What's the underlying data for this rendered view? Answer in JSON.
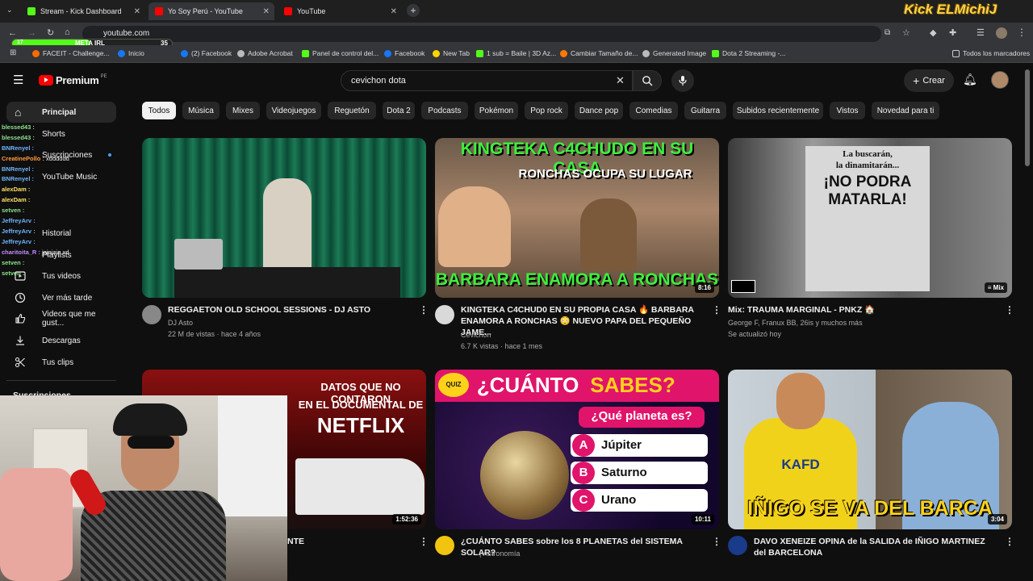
{
  "browser": {
    "tabs": [
      {
        "label": "Stream - Kick Dashboard",
        "color": "#53fc18"
      },
      {
        "label": "Yo Soy Perú - YouTube",
        "color": "#ff0000"
      },
      {
        "label": "YouTube",
        "color": "#ff0000"
      }
    ],
    "url": "youtube.com",
    "bookmarks": [
      "FACEIT - Challenge...",
      "Inicio",
      "(2) Facebook",
      "Adobe Acrobat",
      "Panel de control del...",
      "Facebook",
      "New Tab",
      "1 sub = Baile | 3D Az...",
      "Cambiar Tamaño de...",
      "Generated Image",
      "Dota 2 Streaming -...",
      "Todos los marcadores"
    ]
  },
  "overlay": {
    "brand": "Kick ELMichiJ",
    "meta_label": "META IRL",
    "meta_current": "17",
    "meta_goal": "35",
    "meta_fraction": 0.49,
    "chat": [
      {
        "user": "blessed43 :",
        "msg": ""
      },
      {
        "user": "blessed43 :",
        "msg": ""
      },
      {
        "user": "BNRenyel :",
        "msg": ""
      },
      {
        "user": "CreatinePollo :",
        "msg": "xdddddd"
      },
      {
        "user": "BNRenyel :",
        "msg": ""
      },
      {
        "user": "BNRenyel :",
        "msg": ""
      },
      {
        "user": "alexDam :",
        "msg": ""
      },
      {
        "user": "alexDam :",
        "msg": ""
      },
      {
        "user": "setven :",
        "msg": ""
      },
      {
        "user": "JeffreyArv :",
        "msg": ""
      },
      {
        "user": "JeffreyArv :",
        "msg": ""
      },
      {
        "user": "JeffreyArv :",
        "msg": ""
      },
      {
        "user": "charitoita_R :",
        "msg": "jajajaja xd"
      },
      {
        "user": "setven :",
        "msg": ""
      },
      {
        "user": "setven :",
        "msg": ""
      }
    ]
  },
  "header": {
    "logo": "Premium",
    "region": "PE",
    "search_value": "cevichon dota",
    "create_label": "Crear"
  },
  "chips": [
    "Todos",
    "Música",
    "Mixes",
    "Videojuegos",
    "Reguetón",
    "Dota 2",
    "Podcasts",
    "Pokémon",
    "Pop rock",
    "Dance pop",
    "Comedias",
    "Guitarra",
    "Subidos recientemente",
    "Vistos",
    "Novedad para ti"
  ],
  "sidebar": {
    "items": [
      "Principal",
      "Shorts",
      "Suscripciones",
      "YouTube Music",
      "Historial",
      "Playlists",
      "Tus videos",
      "Ver más tarde",
      "Videos que me gust...",
      "Descargas",
      "Tus clips"
    ],
    "section": "Suscripciones"
  },
  "videos": [
    {
      "title": "REGGAETON OLD SCHOOL SESSIONS - DJ ASTO",
      "channel": "DJ Asto",
      "stats": "22 M de vistas · hace 4 años",
      "duration": ""
    },
    {
      "title": "KINGTEKA C4CHUD0 EN SU PROPIA CASA 🔥 BARBARA ENAMORA A RONCHAS 😳 NUEVO PAPA DEL PEQUEÑO JAME...",
      "channel": "Cevichon",
      "stats": "6.7 K vistas · hace 1 mes",
      "duration": "8:16",
      "thumb_top": "KINGTEKA C4CHUDO EN SU CASA",
      "thumb_mid": "RONCHAS OCUPA SU LUGAR",
      "thumb_bottom": "BARBARA ENAMORA A RONCHAS"
    },
    {
      "title": "Mix: TRAUMA MARGINAL - PNKZ 🏠",
      "channel": "George F, Franux BB, 26is y muchos más",
      "stats": "Se actualizó hoy",
      "duration": "Mix",
      "thumb_line1": "La buscarán,",
      "thumb_line2": "la dinamitarán...",
      "thumb_main": "¡NO PODRA MATARLA!"
    },
    {
      "title": "",
      "channel": "",
      "stats": "",
      "duration": "1:52:36",
      "title_tail": "NTE",
      "thumb_line1": "DATOS QUE NO CONTARON",
      "thumb_line2": "EN EL DOCUMENTAL DE",
      "thumb_main": "NETFLIX"
    },
    {
      "title": "¿CUÁNTO SABES sobre los 8 PLANETAS del SISTEMA SOLAR?",
      "channel": "| Astronomía",
      "stats": "",
      "duration": "10:11",
      "thumb_head1": "¿CUÁNTO",
      "thumb_head2": "SABES?",
      "thumb_q": "¿Qué planeta es?",
      "options": [
        {
          "k": "A",
          "v": "Júpiter"
        },
        {
          "k": "B",
          "v": "Saturno"
        },
        {
          "k": "C",
          "v": "Urano"
        }
      ],
      "badge": "QUIZ"
    },
    {
      "title": "DAVO XENEIZE OPINA de la SALIDA de IÑIGO MARTINEZ del BARCELONA",
      "channel": "",
      "stats": "",
      "duration": "3:04",
      "thumb_main": "IÑIGO SE VA DEL BARCA",
      "jersey": "KAFD"
    }
  ]
}
